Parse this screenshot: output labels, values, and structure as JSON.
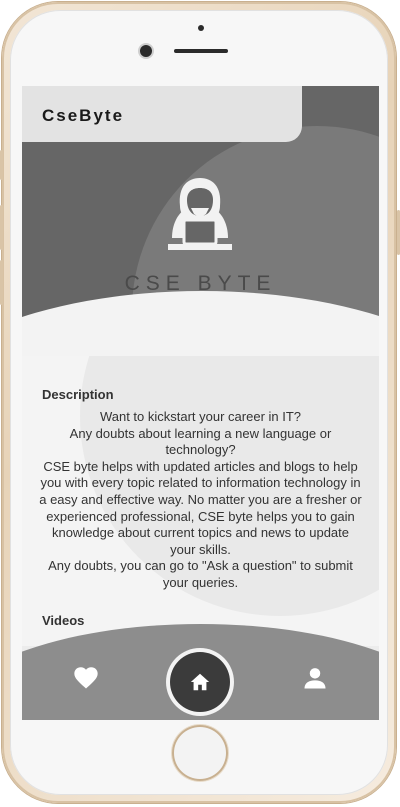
{
  "app": {
    "title": "CseByte",
    "brand": "CSE BYTE"
  },
  "description": {
    "heading": "Description",
    "body": "Want to kickstart your career in IT?\nAny doubts about learning a new language or technology?\nCSE byte helps with updated articles and blogs to help you with every topic related to information technology in a easy and effective way. No matter you are a fresher or experienced professional, CSE byte helps you to gain knowledge about current topics and news to update your skills.\nAny doubts, you can go to \"Ask a question\" to submit your queries."
  },
  "sections": {
    "videos_heading": "Videos"
  },
  "nav": {
    "left_icon": "heart-icon",
    "center_icon": "home-icon",
    "right_icon": "person-icon"
  },
  "colors": {
    "hero_dark": "#666666",
    "nav_gray": "#8d8d8d",
    "fab_dark": "#3b3b3b"
  }
}
